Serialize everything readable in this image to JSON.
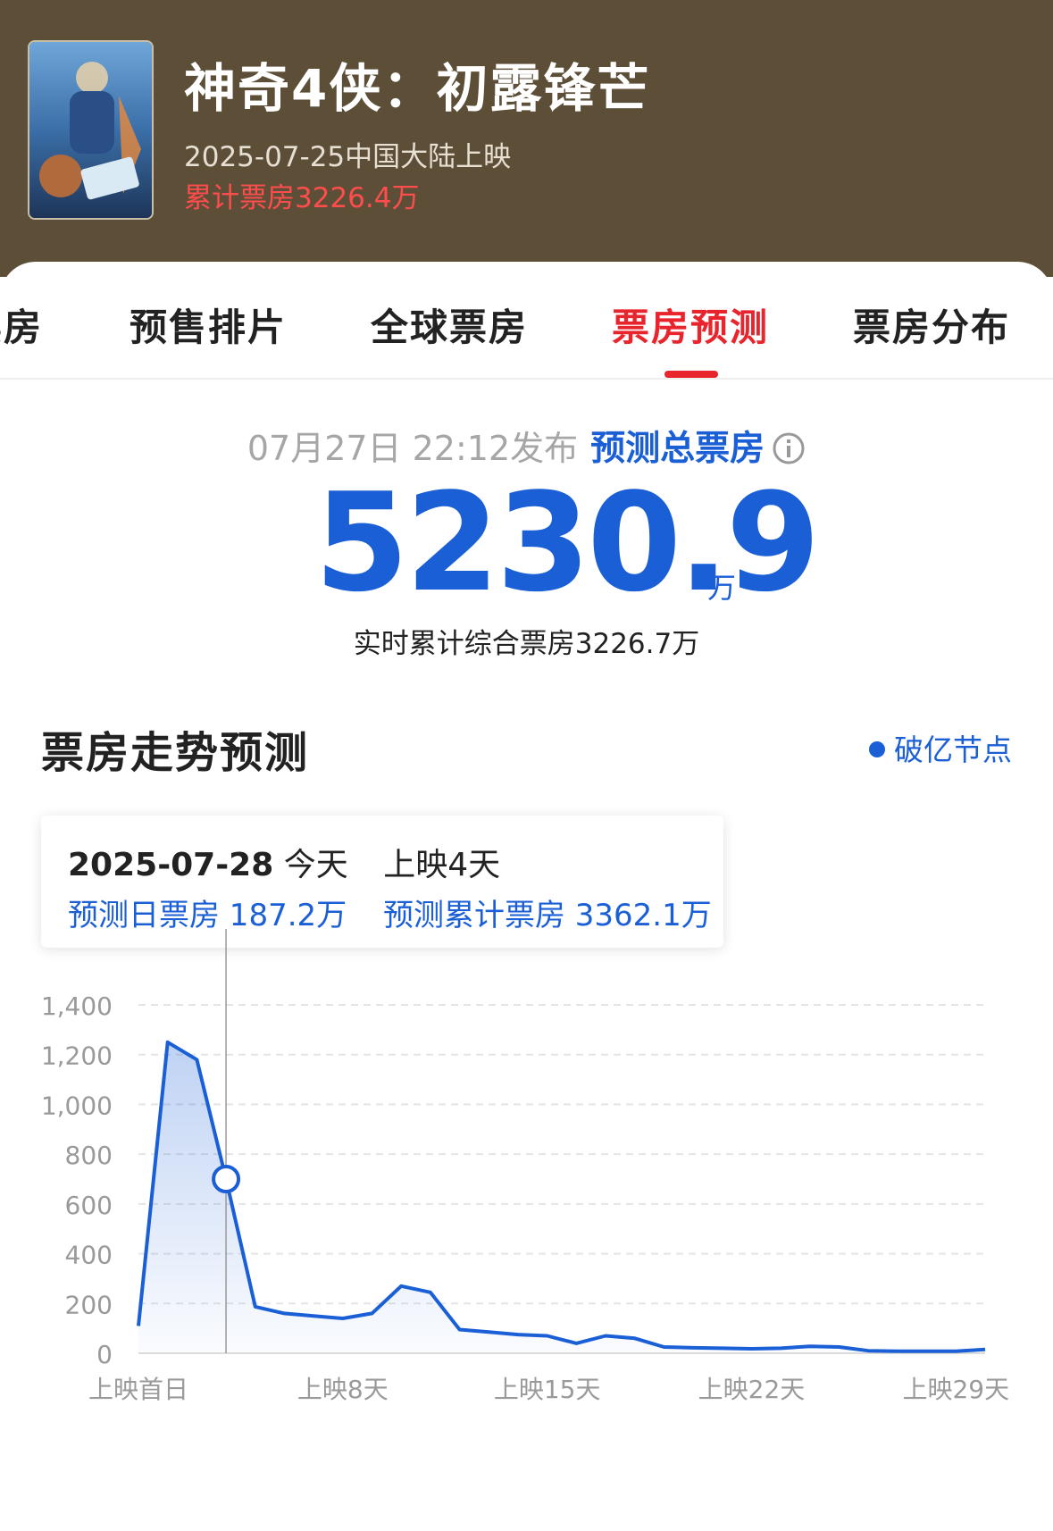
{
  "movie": {
    "title": "神奇4侠：初露锋芒",
    "release_info": "2025-07-25中国大陆上映",
    "cumulative_box": "累计票房3226.4万"
  },
  "tabs": [
    {
      "label": "票房"
    },
    {
      "label": "预售排片"
    },
    {
      "label": "全球票房"
    },
    {
      "label": "票房预测",
      "active": true
    },
    {
      "label": "票房分布"
    }
  ],
  "forecast": {
    "publish_time": "07月27日 22:12发布",
    "label": "预测总票房",
    "total": "5230.9",
    "unit": "万",
    "realtime_text": "实时累计综合票房3226.7万"
  },
  "trend": {
    "title": "票房走势预测",
    "legend": "破亿节点"
  },
  "tooltip": {
    "date": "2025-07-28",
    "today": "今天",
    "day_label": "上映4天",
    "daily": "预测日票房 187.2万",
    "cumulative": "预测累计票房 3362.1万"
  },
  "colors": {
    "header_bg": "#5d4e37",
    "accent_red": "#e8242c",
    "accent_blue": "#1a5fd6",
    "cumulative_red": "#ff4d4d"
  },
  "chart_data": {
    "type": "area",
    "x": [
      1,
      2,
      3,
      4,
      5,
      6,
      7,
      8,
      9,
      10,
      11,
      12,
      13,
      14,
      15,
      16,
      17,
      18,
      19,
      20,
      21,
      22,
      23,
      24,
      25,
      26,
      27,
      28,
      29,
      30
    ],
    "values": [
      110,
      1250,
      1180,
      700,
      187,
      160,
      150,
      140,
      160,
      270,
      245,
      95,
      85,
      75,
      70,
      40,
      70,
      60,
      25,
      22,
      20,
      18,
      20,
      28,
      25,
      10,
      8,
      8,
      8,
      15
    ],
    "highlight_index": 3,
    "y_ticks": [
      0,
      200,
      400,
      600,
      800,
      1000,
      1200,
      1400
    ],
    "y_tick_labels": [
      "0",
      "200",
      "400",
      "600",
      "800",
      "1,000",
      "1,200",
      "1,400"
    ],
    "ylim": [
      0,
      1400
    ],
    "x_tick_labels": [
      {
        "day": 1,
        "label": "上映首日"
      },
      {
        "day": 8,
        "label": "上映8天"
      },
      {
        "day": 15,
        "label": "上映15天"
      },
      {
        "day": 22,
        "label": "上映22天"
      },
      {
        "day": 29,
        "label": "上映29天"
      }
    ],
    "grid": true
  }
}
